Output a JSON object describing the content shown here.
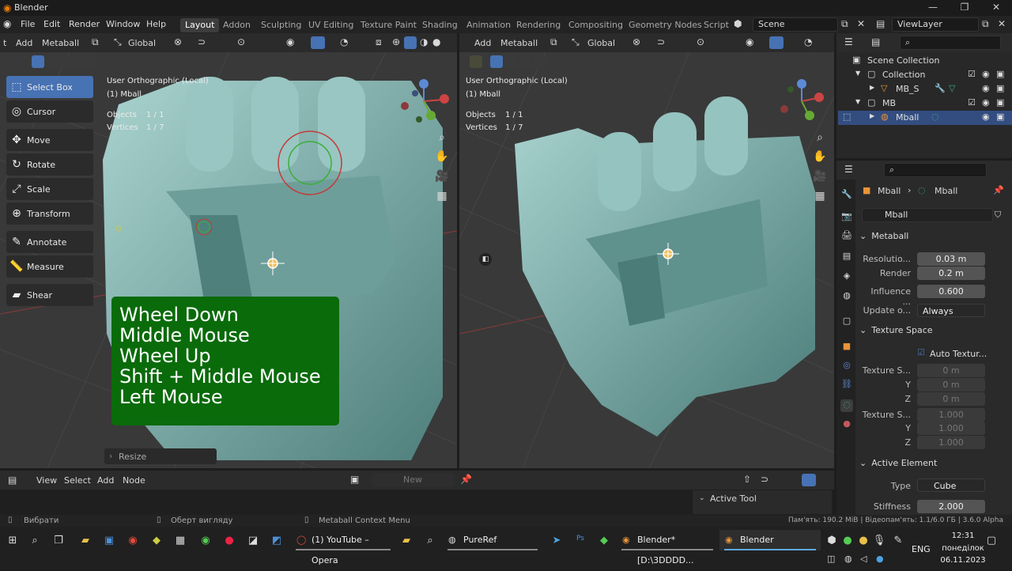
{
  "window": {
    "title": "Blender"
  },
  "menus": [
    "File",
    "Edit",
    "Render",
    "Window",
    "Help"
  ],
  "workspaces": [
    "Layout",
    "Addon",
    "Sculpting",
    "UV Editing",
    "Texture Paint",
    "Shading",
    "Animation",
    "Rendering",
    "Compositing",
    "Geometry Nodes",
    "Script"
  ],
  "active_workspace": "Layout",
  "scene": {
    "value": "Scene"
  },
  "view_layer": {
    "value": "ViewLayer"
  },
  "left_viewport": {
    "header": {
      "mode_fragment": "t",
      "add": "Add",
      "metaball": "Metaball",
      "orientation": "Global"
    },
    "view_name": "User Orthographic (Local)",
    "object_name": "(1) Mball",
    "stats": {
      "objects_label": "Objects",
      "objects_value": "1 / 1",
      "vertices_label": "Vertices",
      "vertices_value": "1 / 7"
    },
    "tools": [
      {
        "label": "Select Box",
        "icon": "select-box-icon",
        "glyph": "⬚"
      },
      {
        "label": "Cursor",
        "icon": "cursor-icon",
        "glyph": "◎"
      },
      {
        "label": "Move",
        "icon": "move-icon",
        "glyph": "✥"
      },
      {
        "label": "Rotate",
        "icon": "rotate-icon",
        "glyph": "↻"
      },
      {
        "label": "Scale",
        "icon": "scale-icon",
        "glyph": "⤢"
      },
      {
        "label": "Transform",
        "icon": "transform-icon",
        "glyph": "⊕"
      },
      {
        "label": "Annotate",
        "icon": "annotate-icon",
        "glyph": "✎"
      },
      {
        "label": "Measure",
        "icon": "measure-icon",
        "glyph": "📏"
      },
      {
        "label": "Shear",
        "icon": "shear-icon",
        "glyph": "▰"
      }
    ],
    "resize_panel": "Resize",
    "overlay_lines": [
      "Wheel Down",
      "Middle Mouse",
      "Wheel Up",
      "Shift + Middle Mouse",
      "Left Mouse"
    ]
  },
  "right_viewport": {
    "header": {
      "add": "Add",
      "metaball": "Metaball",
      "orientation": "Global"
    },
    "view_name": "User Orthographic (Local)",
    "object_name": "(1) Mball",
    "stats": {
      "objects_label": "Objects",
      "objects_value": "1 / 1",
      "vertices_label": "Vertices",
      "vertices_value": "1 / 7"
    }
  },
  "outliner": {
    "rows": [
      {
        "label": "Scene Collection",
        "icon": "scene-collection-icon"
      },
      {
        "label": "Collection",
        "icon": "collection-icon"
      },
      {
        "label": "MB_S",
        "icon": "mesh-icon"
      },
      {
        "label": "MB",
        "icon": "collection-icon"
      },
      {
        "label": "Mball",
        "icon": "metaball-icon"
      }
    ]
  },
  "properties": {
    "breadcrumb": [
      "Mball",
      "Mball"
    ],
    "datablock": "Mball",
    "metaball_section": "Metaball",
    "resolution_label": "Resolutio...",
    "resolution_value": "0.03 m",
    "render_label": "Render",
    "render_value": "0.2 m",
    "influence_label": "Influence ...",
    "influence_value": "0.600",
    "update_label": "Update o...",
    "update_value": "Always",
    "texture_space_section": "Texture Space",
    "auto_texture_label": "Auto Textur...",
    "tex_loc_label": "Texture S...",
    "tex_loc_x": "0 m",
    "tex_loc_y_label": "Y",
    "tex_loc_y": "0 m",
    "tex_loc_z_label": "Z",
    "tex_loc_z": "0 m",
    "tex_size_label": "Texture S...",
    "tex_size_x": "1.000",
    "tex_size_y_label": "Y",
    "tex_size_y": "1.000",
    "tex_size_z_label": "Z",
    "tex_size_z": "1.000",
    "active_element_section": "Active Element",
    "type_label": "Type",
    "type_value": "Cube",
    "stiffness_label": "Stiffness",
    "stiffness_value": "2.000"
  },
  "node_editor": {
    "view": "View",
    "select": "Select",
    "add": "Add",
    "node": "Node",
    "new_button": "New",
    "active_tool": "Active Tool"
  },
  "statusbar": {
    "left1": "Вибрати",
    "left2": "Оберт вигляду",
    "left3": "Metaball Context Menu",
    "right": "Пам'ять: 190.2 MiB | Відеопам'ять: 1.1/6.0 ГБ | 3.6.0 Alpha"
  },
  "taskbar": {
    "apps": [
      {
        "label": "(1) YouTube – Opera",
        "icon": "opera-icon"
      },
      {
        "label": "PureRef",
        "icon": "pureref-icon"
      },
      {
        "label": "Blender* [D:\\3DDDD...",
        "icon": "blender-icon"
      },
      {
        "label": "Blender",
        "icon": "blender-icon"
      }
    ],
    "language": "ENG",
    "time": "12:31",
    "day": "понеділок",
    "date": "06.11.2023"
  },
  "colors": {
    "accent": "#4772b3",
    "overlay_green": "#0a6b0a",
    "mesh": "#7fb0ac",
    "header": "#2b2b2b"
  }
}
